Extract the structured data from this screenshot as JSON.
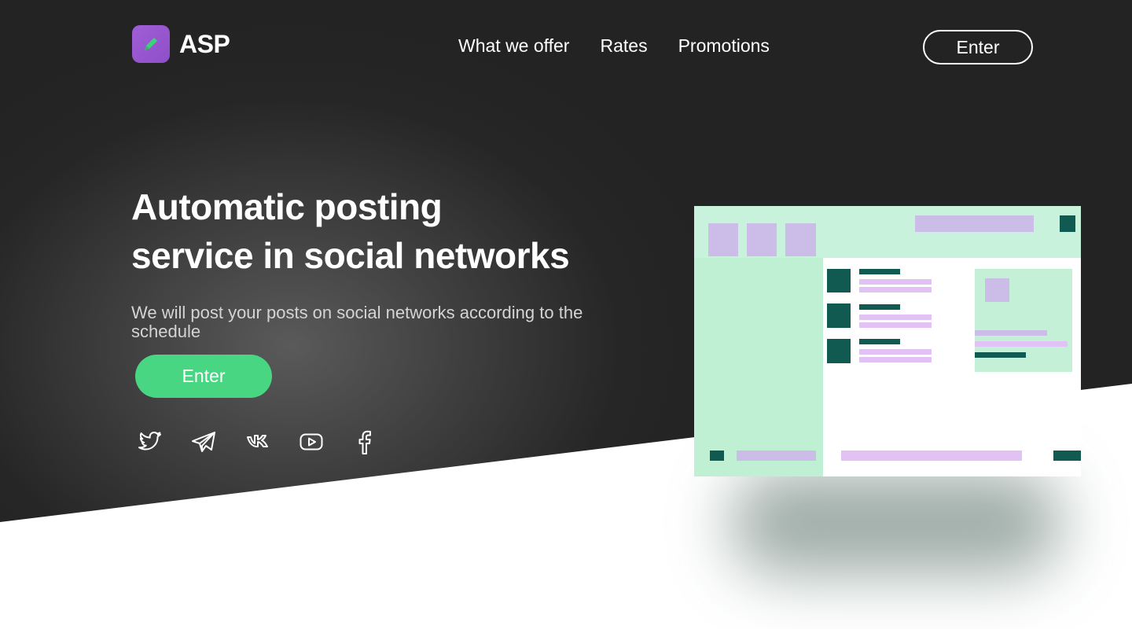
{
  "brand": {
    "name": "ASP",
    "logo_icon": "pencil-icon",
    "logo_color": "#9b59d0"
  },
  "nav": {
    "items": [
      {
        "label": "What we offer"
      },
      {
        "label": "Rates"
      },
      {
        "label": "Promotions"
      }
    ]
  },
  "header": {
    "enter_label": "Enter"
  },
  "hero": {
    "title_line1": "Automatic posting",
    "title_line2": "service in social networks",
    "subtitle": "We will post your posts on social networks according to the schedule",
    "cta_label": "Enter",
    "cta_color": "#49d683"
  },
  "socials": [
    {
      "icon": "twitter-icon"
    },
    {
      "icon": "telegram-icon"
    },
    {
      "icon": "vk-icon"
    },
    {
      "icon": "youtube-icon"
    },
    {
      "icon": "facebook-icon"
    }
  ],
  "colors": {
    "hero_dark": "#232323",
    "mockup_green": "#c3f0d6",
    "mockup_teal": "#115a52",
    "mockup_lavender": "#cbbde8",
    "mockup_pink": "#e2c2f5"
  }
}
